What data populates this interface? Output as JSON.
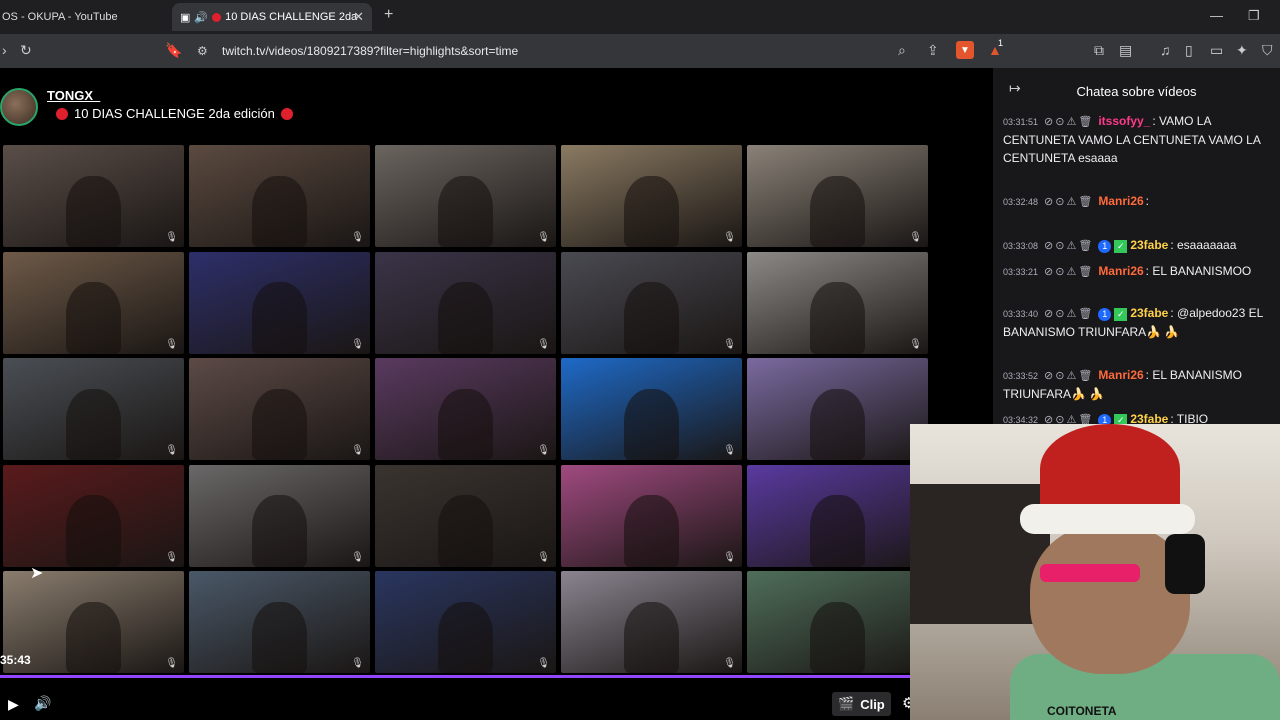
{
  "browser": {
    "tabs": [
      {
        "label": "OS - OKUPA - YouTube"
      },
      {
        "label": "10 DIAS CHALLENGE 2da"
      }
    ],
    "url": "twitch.tv/videos/1809217389?filter=highlights&sort=time",
    "extension_badge": "1"
  },
  "stream": {
    "streamer": "TONGX_",
    "title": "10 DIAS CHALLENGE 2da edición",
    "time": "35:43"
  },
  "grid_colors": [
    "#5a4e48",
    "#5b4a40",
    "#6b6560",
    "#8a7a62",
    "#8a8278",
    "#6e5a48",
    "#2d2f6a",
    "#3a3448",
    "#4a4a52",
    "#8c8a86",
    "#4a4f55",
    "#5c4a46",
    "#5a3a60",
    "#1e6ac8",
    "#7a6aa0",
    "#5a1a1c",
    "#6a6868",
    "#3a3430",
    "#a04a80",
    "#5a3aa0",
    "#8a7d6e",
    "#4a5868",
    "#2a3660",
    "#8a8490",
    "#4f6e5a"
  ],
  "controls": {
    "clip_label": "Clip"
  },
  "chat": {
    "title": "Chatea sobre vídeos",
    "messages": [
      {
        "ts": "03:31:51",
        "user": "itssofyy_",
        "user_color": "#ff3a8a",
        "text": ": VAMO LA CENTUNETA  VAMO LA CENTUNETA  VAMO LA CENTUNETA  esaaaa"
      },
      {
        "ts": "03:32:48",
        "user": "Manri26",
        "user_color": "#ff6a3a",
        "text": ":"
      },
      {
        "ts": "03:33:08",
        "user": "23fabe",
        "user_color": "#ffd24a",
        "text": ": esaaaaaaa"
      },
      {
        "ts": "03:33:21",
        "user": "Manri26",
        "user_color": "#ff6a3a",
        "text": ": EL BANANISMOO"
      },
      {
        "ts": "03:33:40",
        "user": "23fabe",
        "user_color": "#ffd24a",
        "text": ": @alpedoo23 EL BANANISMO TRIUNFARA🍌 🍌"
      },
      {
        "ts": "03:33:52",
        "user": "Manri26",
        "user_color": "#ff6a3a",
        "text": ": EL BANANISMO TRIUNFARA🍌 🍌"
      },
      {
        "ts": "03:34:32",
        "user": "23fabe",
        "user_color": "#ffd24a",
        "text": ": TIBIO"
      }
    ]
  },
  "webcam": {
    "caption": "COITONETA"
  }
}
